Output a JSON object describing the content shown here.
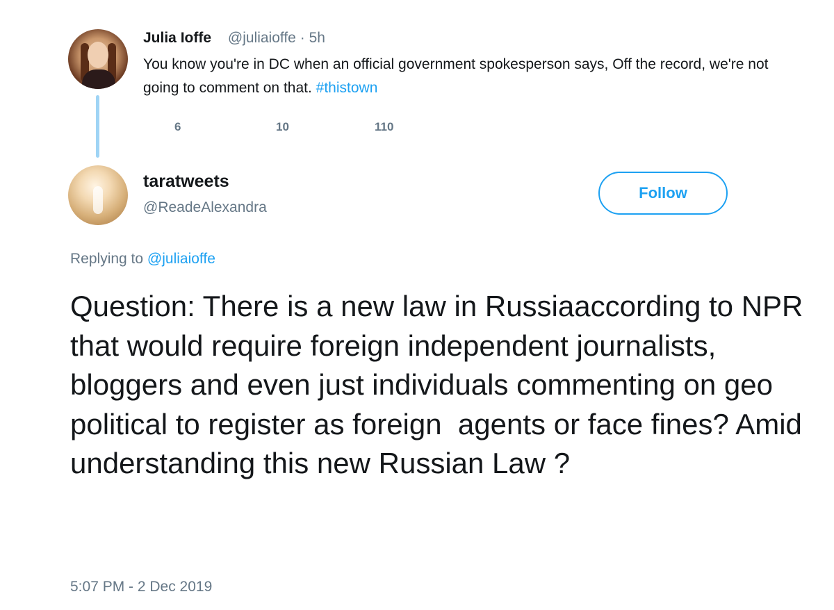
{
  "parent_tweet": {
    "name": "Julia Ioffe",
    "handle": "@juliaioffe",
    "separator": "·",
    "time": "5h",
    "text": "You know you're in DC when an official government spokesperson says, Off the record, we're not going to comment on that.",
    "hashtag": "#thistown",
    "stats": {
      "replies": "6",
      "retweets": "10",
      "likes": "110"
    }
  },
  "reply_tweet": {
    "name": "taratweets",
    "handle": "@ReadeAlexandra",
    "follow_label": "Follow",
    "replying_prefix": "Replying to",
    "replying_handle": "@juliaioffe",
    "text": "Question: There is a new law in Russiaaccording to NPR  that would require foreign independent journalists, bloggers and even just individuals commenting on geo political to register as foreign  agents or face fines? Amid understanding this new Russian Law ?",
    "timestamp": "5:07 PM - 2 Dec 2019"
  },
  "colors": {
    "accent": "#1da1f2",
    "muted": "#657786",
    "text": "#14171a",
    "thread_line": "#9fd4f5"
  }
}
